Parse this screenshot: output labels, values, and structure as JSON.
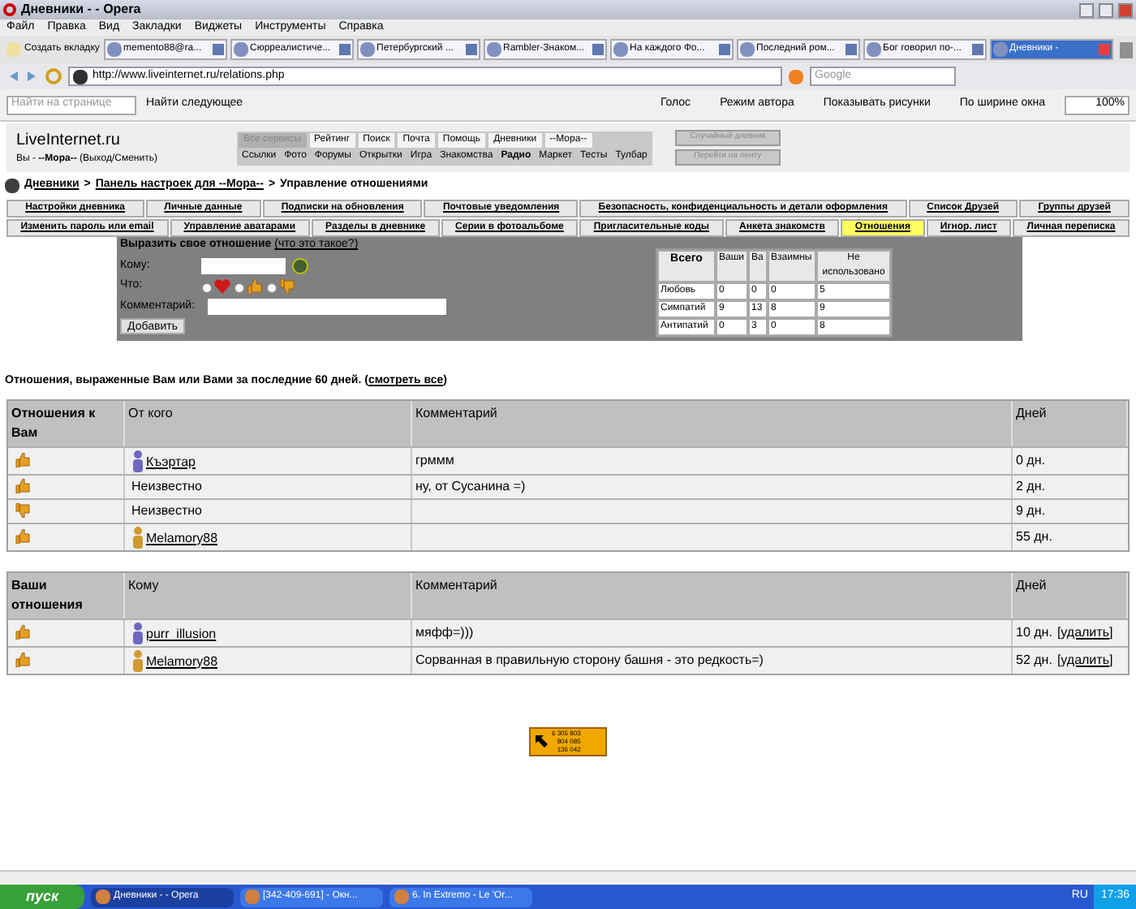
{
  "window": {
    "title": "Дневники - - Opera"
  },
  "menu": [
    "Файл",
    "Правка",
    "Вид",
    "Закладки",
    "Виджеты",
    "Инструменты",
    "Справка"
  ],
  "new_tab": "Создать вкладку",
  "browser_tabs": [
    {
      "label": "memento88@ra...",
      "selected": false
    },
    {
      "label": "Сюрреалистиче...",
      "selected": false
    },
    {
      "label": "Петербургский ...",
      "selected": false
    },
    {
      "label": "Rambler-Знаком...",
      "selected": false
    },
    {
      "label": "На каждого Фо...",
      "selected": false
    },
    {
      "label": "Последний ром...",
      "selected": false
    },
    {
      "label": "Бог говорил по-...",
      "selected": false
    },
    {
      "label": "Дневники -",
      "selected": true
    }
  ],
  "address": "http://www.liveinternet.ru/relations.php",
  "search": {
    "placeholder": "Google"
  },
  "find_bar": {
    "placeholder": "Найти на странице",
    "find_next": "Найти следующее",
    "tools": [
      "Голос",
      "Режим автора",
      "Показывать рисунки",
      "По ширине окна"
    ],
    "zoom": "100%"
  },
  "site": {
    "logo": "LiveInternet.ru",
    "user_line": "Вы - **--Мора--** (Выход/Сменить)",
    "services_top": [
      {
        "label": "Все сервисы",
        "selected": true
      },
      {
        "label": "Рейтинг",
        "selected": false
      },
      {
        "label": "Поиск",
        "selected": false
      },
      {
        "label": "Почта",
        "selected": false
      },
      {
        "label": "Помощь",
        "selected": false
      },
      {
        "label": "Дневники",
        "selected": false
      },
      {
        "label": "--Мора--",
        "selected": false
      }
    ],
    "services_bottom": [
      {
        "label": "Ссылки",
        "bold": false
      },
      {
        "label": "Фото",
        "bold": false
      },
      {
        "label": "Форумы",
        "bold": false
      },
      {
        "label": "Открытки",
        "bold": false
      },
      {
        "label": "Игра",
        "bold": false
      },
      {
        "label": "Знакомства",
        "bold": false
      },
      {
        "label": "Радио",
        "bold": true
      },
      {
        "label": "Маркет",
        "bold": false
      },
      {
        "label": "Тесты",
        "bold": false
      },
      {
        "label": "Тулбар",
        "bold": false
      }
    ],
    "buttons": [
      "Случайный дневник",
      "Перейти на ленту"
    ]
  },
  "breadcrumb": [
    {
      "kind": "link",
      "text": "Дневники"
    },
    {
      "kind": "sep",
      "text": ">"
    },
    {
      "kind": "link",
      "text": "Панель настроек для --Мора--"
    },
    {
      "kind": "sep",
      "text": ">"
    },
    {
      "kind": "current",
      "text": "Управление отношениями"
    }
  ],
  "settings_tabs": [
    [
      {
        "label": "Настройки дневника",
        "selected": false
      },
      {
        "label": "Личные данные",
        "selected": false
      },
      {
        "label": "Подписки на обновления",
        "selected": false
      },
      {
        "label": "Почтовые уведомления",
        "selected": false
      },
      {
        "label": "Безопасность, конфиденциальность и детали оформления",
        "selected": false
      },
      {
        "label": "Список Друзей",
        "selected": false
      },
      {
        "label": "Группы друзей",
        "selected": false
      }
    ],
    [
      {
        "label": "Изменить пароль или email",
        "selected": false
      },
      {
        "label": "Управление аватарами",
        "selected": false
      },
      {
        "label": "Разделы в дневнике",
        "selected": false
      },
      {
        "label": "Серии в фотоальбоме",
        "selected": false
      },
      {
        "label": "Пригласительные коды",
        "selected": false
      },
      {
        "label": "Анкета знакомств",
        "selected": false
      },
      {
        "label": "Отношения",
        "selected": true
      },
      {
        "label": "Игнор. лист",
        "selected": false
      },
      {
        "label": "Личная переписка",
        "selected": false
      }
    ]
  ],
  "form": {
    "title": "Выразить свое отношение",
    "help_link": "(что это такое?)",
    "to_label": "Кому:",
    "what_label": "Что:",
    "comment_label": "Комментарий:",
    "options": [
      {
        "kind": "heart",
        "selected": false
      },
      {
        "kind": "like",
        "selected": false
      },
      {
        "kind": "dislike",
        "selected": false
      }
    ],
    "submit": "Добавить",
    "stats": {
      "columns": [
        "Всего",
        "Ваши",
        "Ва",
        "Взаимны",
        "Не использовано"
      ],
      "rows": [
        [
          "Любовь",
          "0",
          "0",
          "0",
          "5"
        ],
        [
          "Симпатий",
          "9",
          "13",
          "8",
          "9"
        ],
        [
          "Антипатий",
          "0",
          "3",
          "0",
          "8"
        ]
      ]
    }
  },
  "heading": {
    "text": "Отношения, выраженные Вам или Вами за последние 60 дней. (",
    "link": "смотреть все",
    "after": ")"
  },
  "received": {
    "columns": [
      "Отношения к Вам",
      "От кого",
      "Комментарий",
      "Дней"
    ],
    "rows": [
      {
        "kind": "like",
        "user": "Къэртар",
        "color": "#7068c0",
        "comment": "грммм",
        "days": "0 дн."
      },
      {
        "kind": "like",
        "user": "Неизвестно",
        "comment": "ну, от Сусанина =)",
        "days": "2 дн."
      },
      {
        "kind": "dislike",
        "user": "Неизвестно",
        "days": "9 дн."
      },
      {
        "kind": "like",
        "user": "Melamory88",
        "color": "#d09a30",
        "days": "55 дн."
      }
    ]
  },
  "given": {
    "columns": [
      "Ваши отношения",
      "Кому",
      "Комментарий",
      "Дней"
    ],
    "rows": [
      {
        "kind": "like",
        "user": "purr_illusion",
        "color": "#7068c0",
        "comment": "мяфф=)))",
        "days": "10 дн.",
        "delete": "[удалить]"
      },
      {
        "kind": "like",
        "user": "Melamory88",
        "color": "#d09a30",
        "comment": "Сорванная в правильную сторону башня - это редкость=)",
        "days": "52 дн.",
        "delete": "[удалить]"
      }
    ]
  },
  "counter": [
    "6 305 803",
    "804 085",
    "136 042"
  ],
  "taskbar": {
    "start": "пуск",
    "items": [
      {
        "label": "Дневники - - Opera",
        "selected": true
      },
      {
        "label": "[342-409-691] - Окн...",
        "selected": false
      },
      {
        "label": "6. In Extremo - Le 'Or...",
        "selected": false
      }
    ],
    "lang": "RU",
    "time": "17:36"
  }
}
